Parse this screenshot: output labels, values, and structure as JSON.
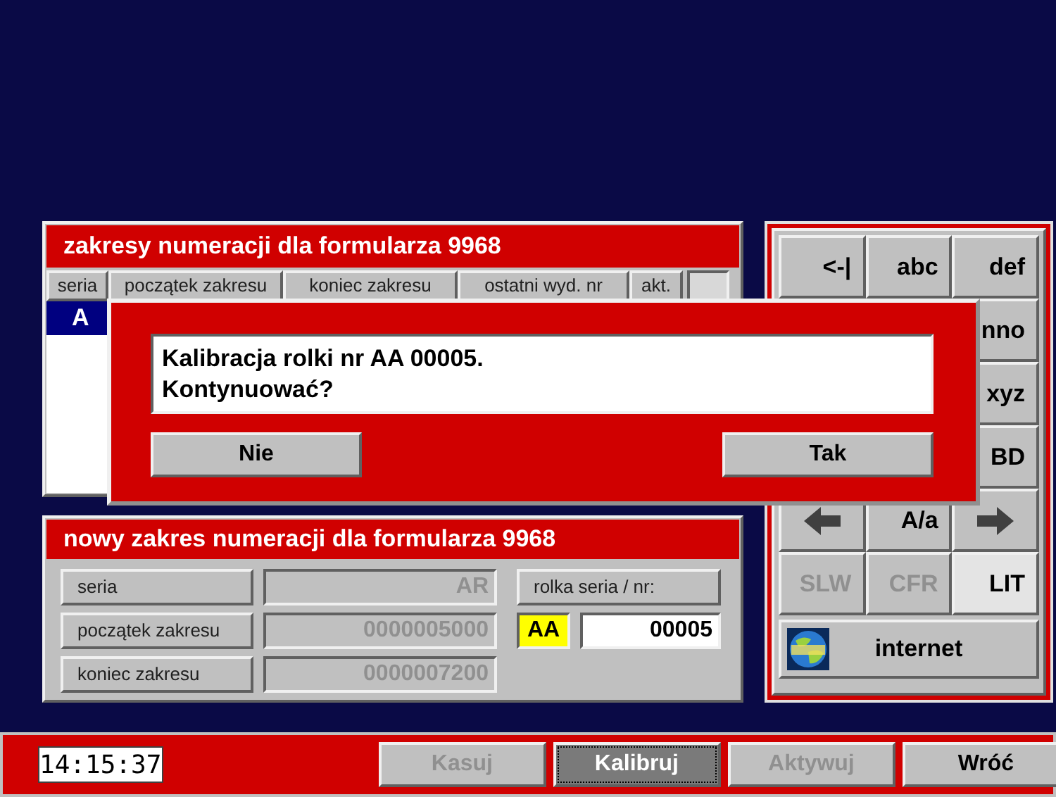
{
  "ranges_panel": {
    "title": "zakresy numeracji dla formularza 9968",
    "columns": [
      "seria",
      "początek zakresu",
      "koniec zakresu",
      "ostatni wyd. nr",
      "akt."
    ],
    "rows": [
      {
        "cells": [
          "A"
        ],
        "selected": true
      }
    ]
  },
  "new_range_panel": {
    "title": "nowy zakres numeracji dla formularza 9968",
    "fields": [
      {
        "label": "seria",
        "value": "AR"
      },
      {
        "label": "początek zakresu",
        "value": "0000005000"
      },
      {
        "label": "koniec zakresu",
        "value": "0000007200"
      }
    ],
    "roll_label": "rolka seria / nr:",
    "roll_series": "AA",
    "roll_number": "00005"
  },
  "keypad": [
    {
      "kind": "text",
      "label": "<-|",
      "disabled": false,
      "selected": false
    },
    {
      "kind": "text",
      "label": "abc",
      "disabled": false,
      "selected": false
    },
    {
      "kind": "text",
      "label": "def",
      "disabled": false,
      "selected": false
    },
    {
      "kind": "hidden"
    },
    {
      "kind": "hidden"
    },
    {
      "kind": "text",
      "label": "nno",
      "disabled": false,
      "selected": false
    },
    {
      "kind": "hidden"
    },
    {
      "kind": "hidden"
    },
    {
      "kind": "text",
      "label": "xyz",
      "disabled": false,
      "selected": false
    },
    {
      "kind": "hidden"
    },
    {
      "kind": "hidden"
    },
    {
      "kind": "text",
      "label": "BD",
      "disabled": false,
      "selected": false
    },
    {
      "kind": "arrow-left",
      "disabled": false,
      "selected": false
    },
    {
      "kind": "text",
      "label": "A/a",
      "disabled": false,
      "selected": false
    },
    {
      "kind": "arrow-right",
      "disabled": false,
      "selected": false
    },
    {
      "kind": "text",
      "label": "SLW",
      "disabled": true,
      "selected": false
    },
    {
      "kind": "text",
      "label": "CFR",
      "disabled": true,
      "selected": false
    },
    {
      "kind": "text",
      "label": "LIT",
      "disabled": false,
      "selected": true
    }
  ],
  "internet_button": "internet",
  "dialog": {
    "message": [
      "Kalibracja rolki nr AA 00005.",
      "Kontynuować?"
    ],
    "buttons": [
      "Nie",
      "Tak"
    ]
  },
  "status_bar": {
    "time": "14:15:37",
    "buttons": [
      {
        "label": "Kasuj",
        "disabled": true,
        "selected": false
      },
      {
        "label": "Kalibruj",
        "disabled": false,
        "selected": true
      },
      {
        "label": "Aktywuj",
        "disabled": true,
        "selected": false
      },
      {
        "label": "Wróć",
        "disabled": false,
        "selected": false
      }
    ]
  }
}
